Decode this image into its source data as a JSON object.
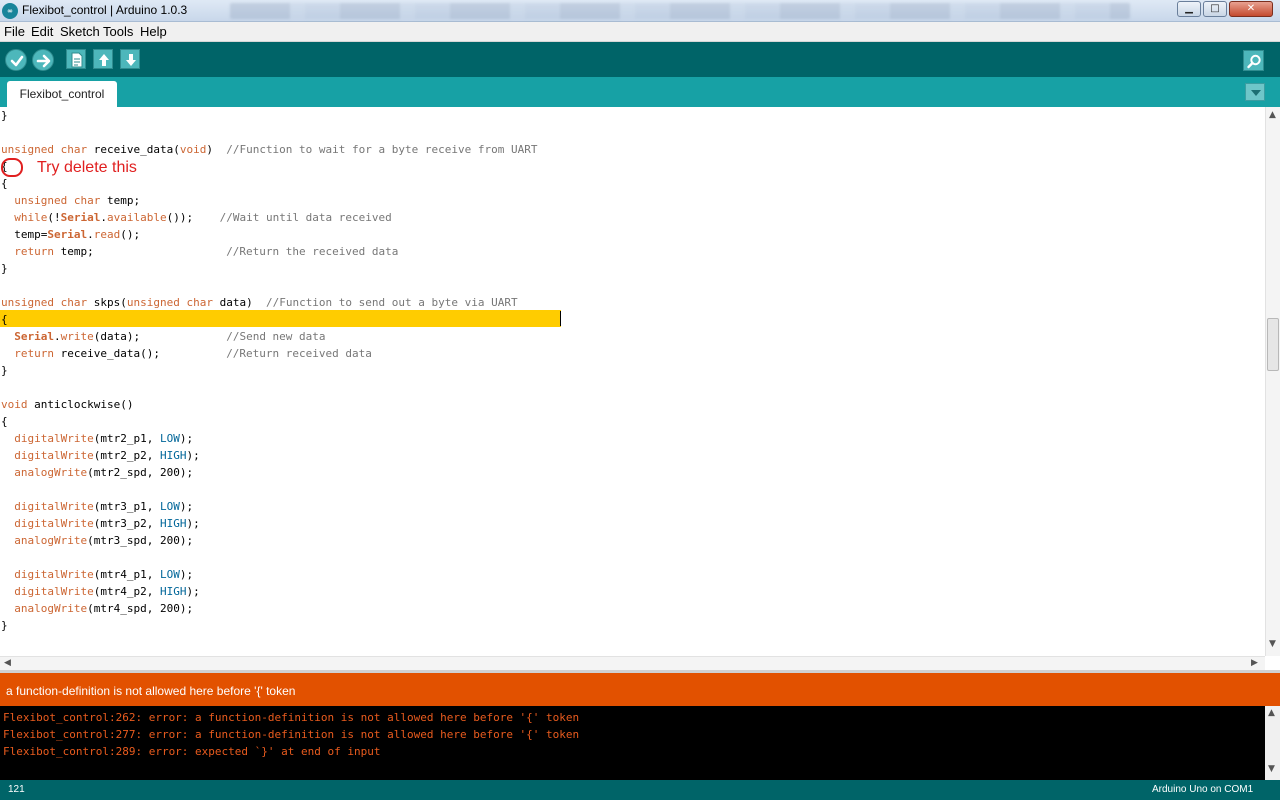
{
  "window": {
    "title": "Flexibot_control | Arduino 1.0.3",
    "app_icon_text": "∞",
    "minimize": "▁",
    "maximize": "□",
    "close": "✕"
  },
  "menu": {
    "file": "File",
    "edit": "Edit",
    "sketch": "Sketch",
    "tools": "Tools",
    "help": "Help"
  },
  "toolbar": {
    "buttons": [
      "verify",
      "upload",
      "new",
      "open",
      "save",
      "serial-monitor"
    ]
  },
  "tab": {
    "label": "Flexibot_control",
    "menu_glyph": "▼"
  },
  "editor": {
    "annotation": "Try delete this",
    "current_line_index": 12,
    "lines": [
      [
        {
          "t": "}",
          "c": "p"
        }
      ],
      [],
      [
        {
          "t": "unsigned",
          "c": "kw"
        },
        {
          "t": " ",
          "c": "p"
        },
        {
          "t": "char",
          "c": "kw"
        },
        {
          "t": " receive_data(",
          "c": "p"
        },
        {
          "t": "void",
          "c": "kw"
        },
        {
          "t": ")  ",
          "c": "p"
        },
        {
          "t": "//Function to wait for a byte receive from UART",
          "c": "cm"
        }
      ],
      [
        {
          "t": "{",
          "c": "p"
        }
      ],
      [
        {
          "t": "{",
          "c": "p"
        }
      ],
      [
        {
          "t": "  ",
          "c": "p"
        },
        {
          "t": "unsigned",
          "c": "kw"
        },
        {
          "t": " ",
          "c": "p"
        },
        {
          "t": "char",
          "c": "kw"
        },
        {
          "t": " temp;",
          "c": "p"
        }
      ],
      [
        {
          "t": "  ",
          "c": "p"
        },
        {
          "t": "while",
          "c": "kw"
        },
        {
          "t": "(!",
          "c": "p"
        },
        {
          "t": "Serial",
          "c": "obj"
        },
        {
          "t": ".",
          "c": "p"
        },
        {
          "t": "available",
          "c": "fn"
        },
        {
          "t": "());    ",
          "c": "p"
        },
        {
          "t": "//Wait until data received",
          "c": "cm"
        }
      ],
      [
        {
          "t": "  temp=",
          "c": "p"
        },
        {
          "t": "Serial",
          "c": "obj"
        },
        {
          "t": ".",
          "c": "p"
        },
        {
          "t": "read",
          "c": "fn"
        },
        {
          "t": "();",
          "c": "p"
        }
      ],
      [
        {
          "t": "  ",
          "c": "p"
        },
        {
          "t": "return",
          "c": "kw"
        },
        {
          "t": " temp;                    ",
          "c": "p"
        },
        {
          "t": "//Return the received data",
          "c": "cm"
        }
      ],
      [
        {
          "t": "}",
          "c": "p"
        }
      ],
      [],
      [
        {
          "t": "unsigned",
          "c": "kw"
        },
        {
          "t": " ",
          "c": "p"
        },
        {
          "t": "char",
          "c": "kw"
        },
        {
          "t": " skps(",
          "c": "p"
        },
        {
          "t": "unsigned",
          "c": "kw"
        },
        {
          "t": " ",
          "c": "p"
        },
        {
          "t": "char",
          "c": "kw"
        },
        {
          "t": " data)  ",
          "c": "p"
        },
        {
          "t": "//Function to send out a byte via UART",
          "c": "cm"
        }
      ],
      [
        {
          "t": "{",
          "c": "p"
        }
      ],
      [
        {
          "t": "  ",
          "c": "p"
        },
        {
          "t": "Serial",
          "c": "obj"
        },
        {
          "t": ".",
          "c": "p"
        },
        {
          "t": "write",
          "c": "fn"
        },
        {
          "t": "(data);             ",
          "c": "p"
        },
        {
          "t": "//Send new data",
          "c": "cm"
        }
      ],
      [
        {
          "t": "  ",
          "c": "p"
        },
        {
          "t": "return",
          "c": "kw"
        },
        {
          "t": " receive_data();          ",
          "c": "p"
        },
        {
          "t": "//Return received data",
          "c": "cm"
        }
      ],
      [
        {
          "t": "}",
          "c": "p"
        }
      ],
      [],
      [
        {
          "t": "void",
          "c": "kw"
        },
        {
          "t": " anticlockwise()",
          "c": "p"
        }
      ],
      [
        {
          "t": "{",
          "c": "p"
        }
      ],
      [
        {
          "t": "  ",
          "c": "p"
        },
        {
          "t": "digitalWrite",
          "c": "fn"
        },
        {
          "t": "(mtr2_p1, ",
          "c": "p"
        },
        {
          "t": "LOW",
          "c": "const"
        },
        {
          "t": ");",
          "c": "p"
        }
      ],
      [
        {
          "t": "  ",
          "c": "p"
        },
        {
          "t": "digitalWrite",
          "c": "fn"
        },
        {
          "t": "(mtr2_p2, ",
          "c": "p"
        },
        {
          "t": "HIGH",
          "c": "const"
        },
        {
          "t": ");",
          "c": "p"
        }
      ],
      [
        {
          "t": "  ",
          "c": "p"
        },
        {
          "t": "analogWrite",
          "c": "fn"
        },
        {
          "t": "(mtr2_spd, 200);",
          "c": "p"
        }
      ],
      [],
      [
        {
          "t": "  ",
          "c": "p"
        },
        {
          "t": "digitalWrite",
          "c": "fn"
        },
        {
          "t": "(mtr3_p1, ",
          "c": "p"
        },
        {
          "t": "LOW",
          "c": "const"
        },
        {
          "t": ");",
          "c": "p"
        }
      ],
      [
        {
          "t": "  ",
          "c": "p"
        },
        {
          "t": "digitalWrite",
          "c": "fn"
        },
        {
          "t": "(mtr3_p2, ",
          "c": "p"
        },
        {
          "t": "HIGH",
          "c": "const"
        },
        {
          "t": ");",
          "c": "p"
        }
      ],
      [
        {
          "t": "  ",
          "c": "p"
        },
        {
          "t": "analogWrite",
          "c": "fn"
        },
        {
          "t": "(mtr3_spd, 200);",
          "c": "p"
        }
      ],
      [],
      [
        {
          "t": "  ",
          "c": "p"
        },
        {
          "t": "digitalWrite",
          "c": "fn"
        },
        {
          "t": "(mtr4_p1, ",
          "c": "p"
        },
        {
          "t": "LOW",
          "c": "const"
        },
        {
          "t": ");",
          "c": "p"
        }
      ],
      [
        {
          "t": "  ",
          "c": "p"
        },
        {
          "t": "digitalWrite",
          "c": "fn"
        },
        {
          "t": "(mtr4_p2, ",
          "c": "p"
        },
        {
          "t": "HIGH",
          "c": "const"
        },
        {
          "t": ");",
          "c": "p"
        }
      ],
      [
        {
          "t": "  ",
          "c": "p"
        },
        {
          "t": "analogWrite",
          "c": "fn"
        },
        {
          "t": "(mtr4_spd, 200);",
          "c": "p"
        }
      ],
      [
        {
          "t": "}",
          "c": "p"
        }
      ]
    ]
  },
  "status": {
    "message": "a function-definition is not allowed here before '{' token"
  },
  "console": {
    "lines": [
      "Flexibot_control:262: error: a function-definition is not allowed here before '{' token",
      "Flexibot_control:277: error: a function-definition is not allowed here before '{' token",
      "Flexibot_control:289: error: expected `}' at end of input"
    ]
  },
  "footer": {
    "line_number": "121",
    "board": "Arduino Uno on COM1"
  },
  "colors": {
    "toolbar": "#006468",
    "tabbar": "#17a1a5",
    "status_error": "#e25100",
    "line_highlight": "#ffcc00",
    "console_text": "#e95b1e"
  }
}
